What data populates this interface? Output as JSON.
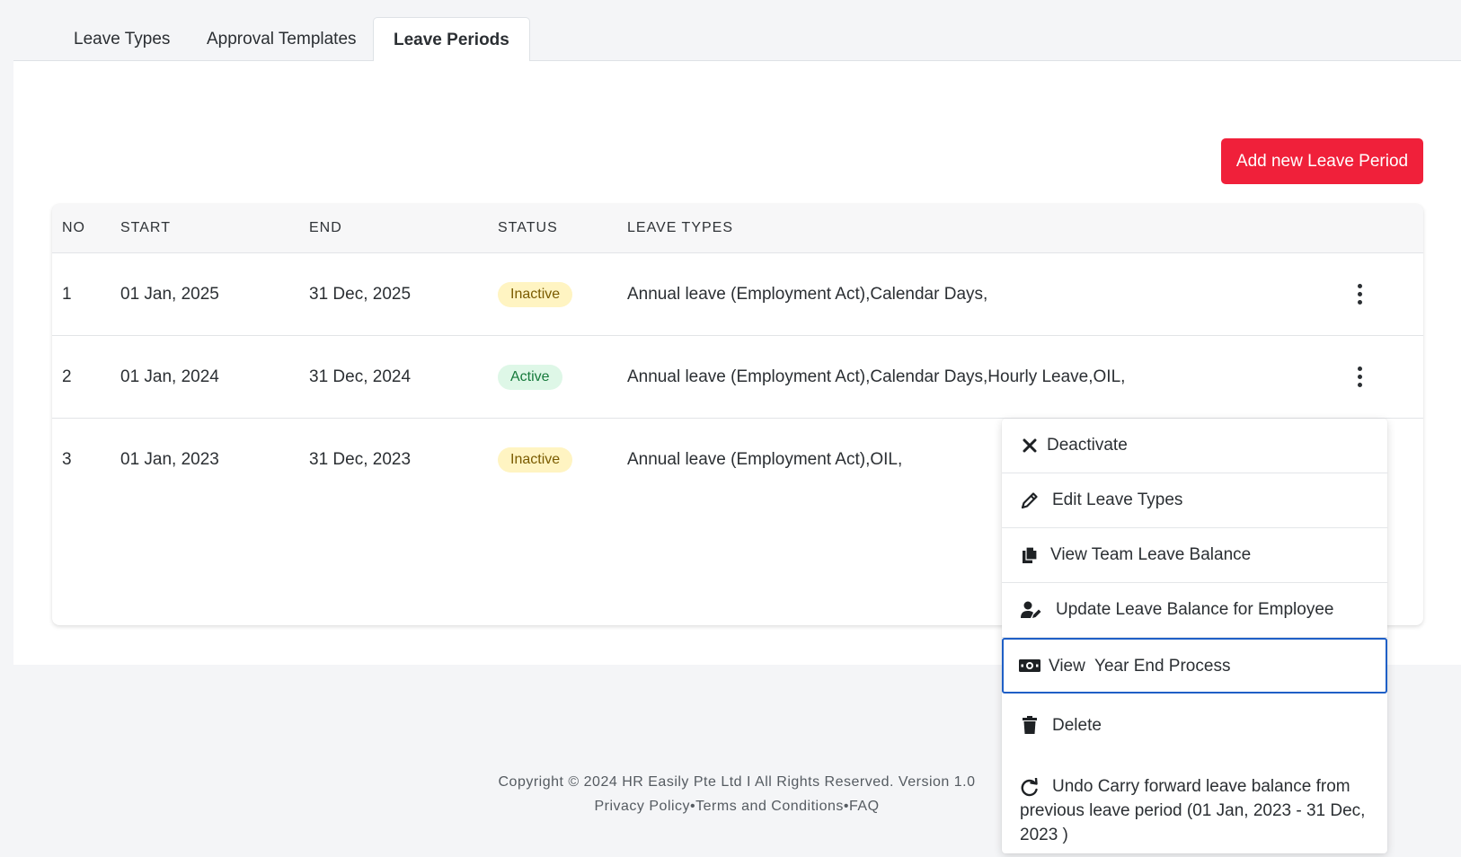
{
  "tabs": [
    {
      "label": "Leave Types",
      "active": false
    },
    {
      "label": "Approval Templates",
      "active": false
    },
    {
      "label": "Leave Periods",
      "active": true
    }
  ],
  "add_button_label": "Add new Leave Period",
  "table": {
    "headers": [
      "NO",
      "START",
      "END",
      "STATUS",
      "LEAVE TYPES"
    ],
    "rows": [
      {
        "no": "1",
        "start": "01 Jan, 2025",
        "end": "31 Dec, 2025",
        "status": "Inactive",
        "leave_types": "Annual leave (Employment Act),Calendar Days,"
      },
      {
        "no": "2",
        "start": "01 Jan, 2024",
        "end": "31 Dec, 2024",
        "status": "Active",
        "leave_types": "Annual leave (Employment Act),Calendar Days,Hourly Leave,OIL,"
      },
      {
        "no": "3",
        "start": "01 Jan, 2023",
        "end": "31 Dec, 2023",
        "status": "Inactive",
        "leave_types": "Annual leave (Employment Act),OIL,"
      }
    ]
  },
  "menu": {
    "items": [
      {
        "label": "Deactivate",
        "icon": "close-icon"
      },
      {
        "label": "Edit Leave Types",
        "icon": "pencil-icon"
      },
      {
        "label": "View Team Leave Balance",
        "icon": "copy-icon"
      },
      {
        "label": "Update Leave Balance for Employee",
        "icon": "user-edit-icon"
      },
      {
        "label": "View  Year End Process",
        "icon": "money-bill-icon"
      },
      {
        "label": "Delete",
        "icon": "trash-icon"
      },
      {
        "label": "Undo Carry forward leave balance from previous leave period (01 Jan, 2023 - 31 Dec, 2023 )",
        "icon": "redo-icon"
      }
    ]
  },
  "footer": {
    "copyright": "Copyright © 2024 HR Easily Pte Ltd I All Rights Reserved. Version 1.0",
    "privacy": "Privacy Policy",
    "terms": "Terms and Conditions",
    "faq": "FAQ",
    "separator": "•"
  },
  "colors": {
    "accent": "#f0203a",
    "inactive_bg": "#fff4c2",
    "active_bg": "#def7e7",
    "focus_border": "#1f5fc6"
  }
}
